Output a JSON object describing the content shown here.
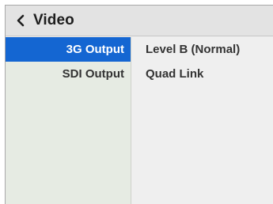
{
  "header": {
    "back_icon": "chevron-left-icon",
    "title": "Video"
  },
  "settings": [
    {
      "label": "3G Output",
      "value": "Level B (Normal)",
      "selected": true
    },
    {
      "label": "SDI Output",
      "value": "Quad Link",
      "selected": false
    }
  ],
  "colors": {
    "selection": "#1466d2",
    "left_panel": "#e6ebe3",
    "right_panel": "#efefef",
    "header": "#e3e3e3"
  }
}
